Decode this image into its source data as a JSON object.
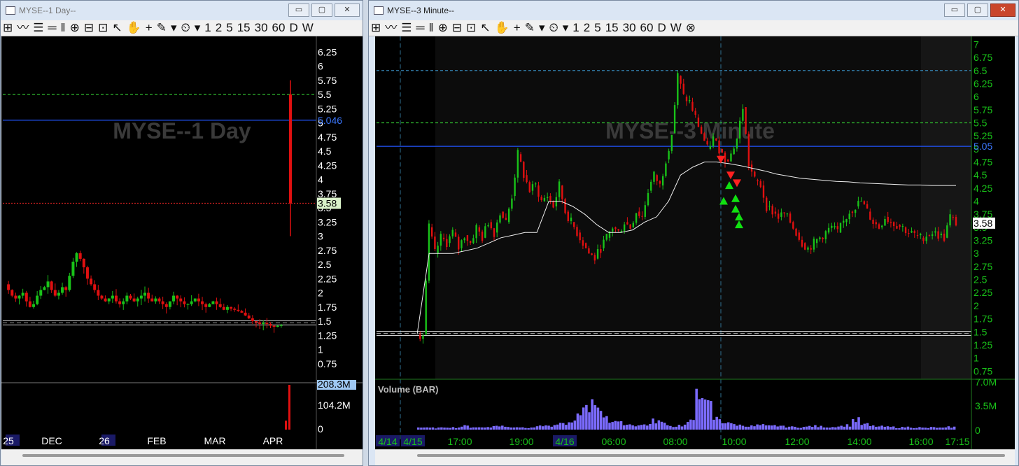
{
  "left_window": {
    "title": "MYSE--1 Day--",
    "watermark": "MYSE--1 Day",
    "toolbar": [
      "⊞",
      "〰",
      "☰",
      "═",
      "‖",
      "⊕",
      "⊟",
      "⊡",
      "↖",
      "✋",
      "+",
      "✎",
      "▾",
      "⏲",
      "▾",
      "1",
      "2",
      "5",
      "15",
      "30",
      "60",
      "D",
      "W"
    ],
    "buttons": {
      "min": "▭",
      "max": "▢",
      "close": "✕"
    }
  },
  "right_window": {
    "title": "MYSE--3 Minute--",
    "watermark": "MYSE--3 Minute",
    "volume_label": "Volume (BAR)",
    "toolbar": [
      "⊞",
      "〰",
      "☰",
      "═",
      "‖",
      "⊕",
      "⊟",
      "⊡",
      "↖",
      "✋",
      "+",
      "✎",
      "▾",
      "⏲",
      "▾",
      "1",
      "2",
      "5",
      "15",
      "30",
      "60",
      "D",
      "W",
      "⊗"
    ],
    "buttons": {
      "min": "▭",
      "max": "▢",
      "close": "✕"
    }
  },
  "chart_data": [
    {
      "type": "candlestick",
      "title": "MYSE--1 Day",
      "colors": {
        "up": "#19c219",
        "down": "#e01010",
        "level_green": "#2fb92f",
        "level_blue": "#2255ff",
        "level_red": "#d02020",
        "axis_text": "#ffffff"
      },
      "ylim": [
        0.5,
        6.5
      ],
      "y_ticks": [
        "6.25",
        "6",
        "5.75",
        "5.5",
        "5.25",
        "5",
        "4.75",
        "4.5",
        "4.25",
        "4",
        "3.75",
        "3.5",
        "3.25",
        "3",
        "2.75",
        "2.5",
        "2.25",
        "2",
        "1.75",
        "1.5",
        "1.25",
        "1",
        "0.75"
      ],
      "x_labels": [
        "25",
        "DEC",
        "26",
        "FEB",
        "MAR",
        "APR"
      ],
      "levels": [
        {
          "value": 5.5,
          "style": "dashed",
          "color": "green"
        },
        {
          "value": 5.046,
          "style": "solid",
          "color": "blue",
          "label": "5.046"
        },
        {
          "value": 3.58,
          "style": "dotted",
          "color": "red"
        },
        {
          "value": 1.47,
          "style": "double",
          "color": "white"
        }
      ],
      "last_price": "3.58",
      "price_path": [
        2.15,
        2.05,
        1.95,
        1.9,
        1.95,
        2.0,
        1.85,
        1.75,
        1.8,
        1.95,
        2.05,
        2.1,
        2.2,
        2.05,
        1.95,
        2.0,
        2.1,
        2.05,
        2.3,
        2.55,
        2.7,
        2.6,
        2.45,
        2.25,
        2.15,
        2.05,
        1.95,
        1.9,
        1.85,
        1.9,
        1.95,
        1.85,
        1.8,
        1.85,
        1.95,
        1.9,
        1.85,
        1.9,
        1.95,
        2.0,
        1.9,
        1.85,
        1.9,
        1.85,
        1.8,
        1.75,
        1.85,
        1.95,
        1.9,
        1.85,
        1.8,
        1.8,
        1.85,
        1.9,
        1.85,
        1.8,
        1.75,
        1.8,
        1.85,
        1.8,
        1.75,
        1.7,
        1.75,
        1.72,
        1.7,
        1.68,
        1.65,
        1.6,
        1.55,
        1.5,
        1.48,
        1.45,
        1.47,
        1.45,
        1.42,
        1.4,
        1.42,
        1.43
      ],
      "last_bar": {
        "open": 1.5,
        "high": 5.75,
        "low": 3.0,
        "close": 3.58
      },
      "volume": {
        "ticks": [
          "208.3M",
          "104.2M",
          "0"
        ],
        "max_label": "208.3M",
        "last_bars": [
          0.2,
          1.0
        ]
      }
    },
    {
      "type": "candlestick",
      "title": "MYSE--3 Minute",
      "colors": {
        "up": "#19c219",
        "down": "#e01010",
        "vwap": "#f0f0f0",
        "level_green": "#2fb92f",
        "level_blue": "#2255ff",
        "level_cyan": "#3a93c8",
        "axis_text": "#19c219",
        "volume": "#7b6bff"
      },
      "ylim": [
        0.7,
        7.1
      ],
      "y_ticks": [
        "7",
        "6.75",
        "6.5",
        "6.25",
        "6",
        "5.75",
        "5.5",
        "5.25",
        "5",
        "4.75",
        "4.5",
        "4.25",
        "4",
        "3.75",
        "3.5",
        "3.25",
        "3",
        "2.75",
        "2.5",
        "2.25",
        "2",
        "1.75",
        "1.5",
        "1.25",
        "1",
        "0.75"
      ],
      "x_labels": [
        "4/14",
        "4/15",
        "17:00",
        "19:00",
        "4/16",
        "06:00",
        "08:00",
        "10:00",
        "12:00",
        "14:00",
        "16:00",
        "17:15"
      ],
      "levels": [
        {
          "value": 6.5,
          "style": "dashed",
          "color": "cyan"
        },
        {
          "value": 5.5,
          "style": "dashed",
          "color": "green"
        },
        {
          "value": 5.05,
          "style": "solid",
          "color": "blue",
          "label": "5.05"
        },
        {
          "value": 1.47,
          "style": "double",
          "color": "white"
        }
      ],
      "last_price": "3.58",
      "price_path": [
        1.45,
        1.45,
        3.5,
        3.0,
        3.3,
        3.2,
        3.4,
        3.1,
        3.35,
        3.2,
        3.5,
        3.3,
        3.6,
        3.4,
        3.8,
        3.6,
        4.1,
        4.9,
        4.5,
        4.2,
        4.3,
        4.0,
        4.1,
        3.9,
        4.3,
        3.8,
        3.6,
        3.4,
        3.2,
        3.0,
        2.9,
        3.1,
        3.3,
        3.5,
        3.4,
        3.6,
        3.5,
        3.8,
        3.7,
        4.2,
        4.5,
        4.3,
        4.8,
        5.3,
        6.4,
        6.0,
        5.9,
        5.6,
        5.3,
        5.0,
        5.2,
        5.0,
        4.8,
        4.9,
        5.2,
        5.8,
        4.7,
        4.4,
        4.3,
        3.9,
        3.8,
        3.7,
        3.75,
        3.6,
        3.4,
        3.2,
        3.1,
        3.2,
        3.3,
        3.4,
        3.5,
        3.4,
        3.6,
        3.8,
        3.9,
        4.0,
        3.8,
        3.6,
        3.5,
        3.7,
        3.6,
        3.55,
        3.5,
        3.4,
        3.35,
        3.3,
        3.35,
        3.4,
        3.35,
        3.3,
        3.7,
        3.58
      ],
      "vwap": [
        1.45,
        3.0,
        3.0,
        3.0,
        3.05,
        3.1,
        3.2,
        3.3,
        3.35,
        3.4,
        3.4,
        4.0,
        4.0,
        3.9,
        3.75,
        3.55,
        3.4,
        3.4,
        3.45,
        3.6,
        3.7,
        4.0,
        4.5,
        4.65,
        4.75,
        4.75,
        4.72,
        4.68,
        4.63,
        4.58,
        4.52,
        4.48,
        4.44,
        4.42,
        4.4,
        4.38,
        4.37,
        4.35,
        4.34,
        4.33,
        4.32,
        4.31,
        4.31,
        4.3,
        4.3,
        4.3
      ],
      "buy_signals": 6,
      "sell_signals": 3,
      "volume": {
        "ticks": [
          "7.0M",
          "3.5M",
          "0"
        ],
        "profile": [
          0.05,
          0.04,
          0.04,
          0.06,
          0.05,
          0.08,
          0.06,
          0.05,
          0.07,
          0.09,
          0.06,
          0.06,
          0.05,
          0.06,
          0.1,
          0.08,
          0.12,
          0.15,
          0.3,
          0.45,
          0.7,
          0.35,
          0.2,
          0.15,
          0.12,
          0.1,
          0.12,
          0.2,
          0.15,
          0.08,
          0.1,
          0.18,
          1.0,
          0.55,
          0.25,
          0.18,
          0.12,
          0.1,
          0.08,
          0.1,
          0.08,
          0.09,
          0.07,
          0.06,
          0.06,
          0.08,
          0.07,
          0.06,
          0.08,
          0.1,
          0.22,
          0.12,
          0.08,
          0.07,
          0.06,
          0.05,
          0.06,
          0.05,
          0.04,
          0.05,
          0.04,
          0.06
        ]
      }
    }
  ]
}
